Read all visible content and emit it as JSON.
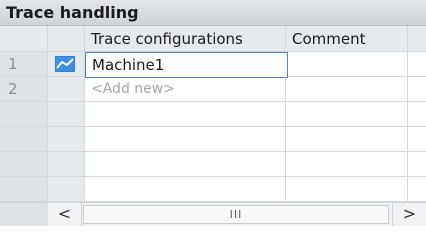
{
  "window": {
    "title": "Trace handling"
  },
  "table": {
    "columns": [
      "Trace configurations",
      "Comment"
    ],
    "rows": [
      {
        "number": "1",
        "name": "Machine1",
        "comment": "",
        "icon": "trace-chart-icon"
      },
      {
        "number": "2",
        "name": "<Add new>",
        "comment": ""
      }
    ]
  },
  "scrollbar": {
    "left_arrow": "<",
    "thumb_grip": "III",
    "right_arrow": ">"
  },
  "colors": {
    "selection_border": "#4a86c8",
    "header_bg": "#e7eaed",
    "icon_blue": "#2f7fd6"
  }
}
